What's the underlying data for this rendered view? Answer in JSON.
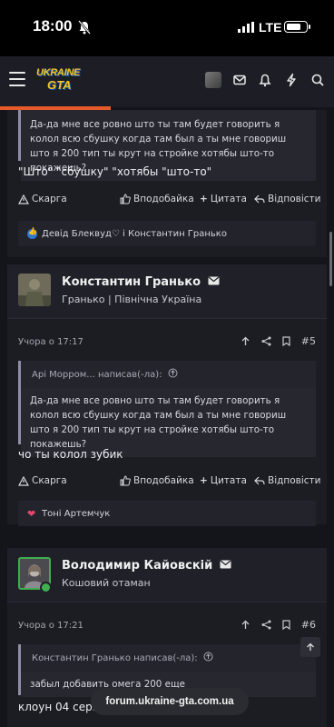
{
  "status": {
    "time": "18:00",
    "network": "LTE"
  },
  "site": {
    "logo_top": "UKRAINE",
    "logo_bottom": "GTA"
  },
  "url": "forum.ukraine-gta.com.ua",
  "post1": {
    "quote_text": "Да-да мне все ровно што ты там будет говорить я колол всю сбушку когда там был а ты мне говориш што я 200 тип ты крут на стройке хотябы што-то покажешь?",
    "message": "\"Што\" \"сбушку\" \"хотябы \"што-то\"",
    "reactions": "Девід Блеквуд♡ і Константин Гранько"
  },
  "post2": {
    "author": "Константин Гранько",
    "title": "Гранько | Північна Україна",
    "date": "Учора о 17:17",
    "number": "#5",
    "quote_header": "Арі Морром... написав(-ла):",
    "quote_text": "Да-да мне все ровно што ты там будет говорить я колол всю сбушку когда там был а ты мне говориш што я 200 тип ты крут на стройке хотябы што-то покажешь?",
    "message": "чо ты колол зубик",
    "reactions": "Тоні Артемчук"
  },
  "post3": {
    "author": "Володимир Кайовскій",
    "title": "Кошовий отаман",
    "date": "Учора о 17:21",
    "number": "#6",
    "quote_header": "Константин Гранько написав(-ла):",
    "quote_text": "забыл добавить омега 200 еще",
    "message": "клоун 04 серв"
  },
  "actions": {
    "report": "Скарга",
    "like": "Вподобайка",
    "quote": "Цитата",
    "reply": "Відповісти"
  },
  "colors": {
    "accent": "#e5592a",
    "online": "#3fae4f"
  }
}
